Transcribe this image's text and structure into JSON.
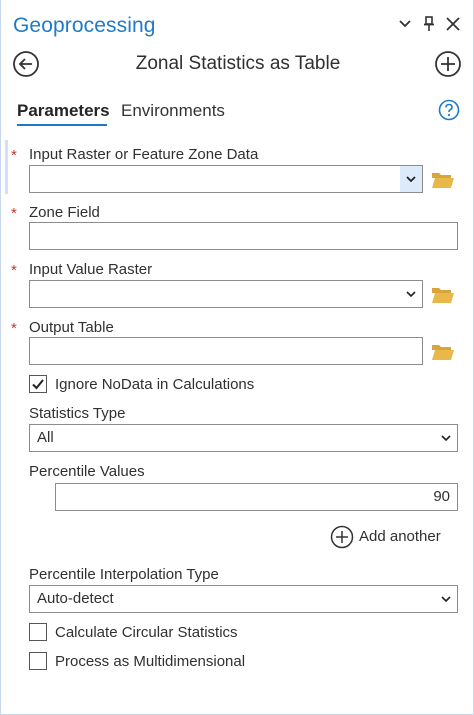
{
  "pane": {
    "title": "Geoprocessing"
  },
  "tool": {
    "title": "Zonal Statistics as Table"
  },
  "tabs": [
    {
      "label": "Parameters",
      "active": true
    },
    {
      "label": "Environments",
      "active": false
    }
  ],
  "params": {
    "input_zone": {
      "label": "Input Raster or Feature Zone Data",
      "value": "",
      "required": true
    },
    "zone_field": {
      "label": "Zone Field",
      "value": "",
      "required": true
    },
    "input_value_raster": {
      "label": "Input Value Raster",
      "value": "",
      "required": true
    },
    "output_table": {
      "label": "Output Table",
      "value": "",
      "required": true
    },
    "ignore_nodata": {
      "label": "Ignore NoData in Calculations",
      "checked": true
    },
    "statistics_type": {
      "label": "Statistics Type",
      "value": "All"
    },
    "percentile_values": {
      "label": "Percentile Values",
      "value": "90"
    },
    "add_another": {
      "label": "Add another"
    },
    "percentile_interpolation": {
      "label": "Percentile Interpolation Type",
      "value": "Auto-detect"
    },
    "circular_statistics": {
      "label": "Calculate Circular Statistics",
      "checked": false
    },
    "multidimensional": {
      "label": "Process as Multidimensional",
      "checked": false
    }
  },
  "required_marker": "*",
  "icons": {
    "back": "back-arrow-icon",
    "add_tool": "plus-circle-icon",
    "help": "help-question-icon",
    "folder": "folder-icon",
    "dropdown": "chevron-down-icon",
    "close": "close-icon",
    "pin": "pin-icon",
    "options": "chevron-down-icon"
  },
  "colors": {
    "accent": "#1f7bc7",
    "required": "#c0392b",
    "folder": "#e8b84a",
    "dropdown_highlight": "#dcebfa"
  }
}
